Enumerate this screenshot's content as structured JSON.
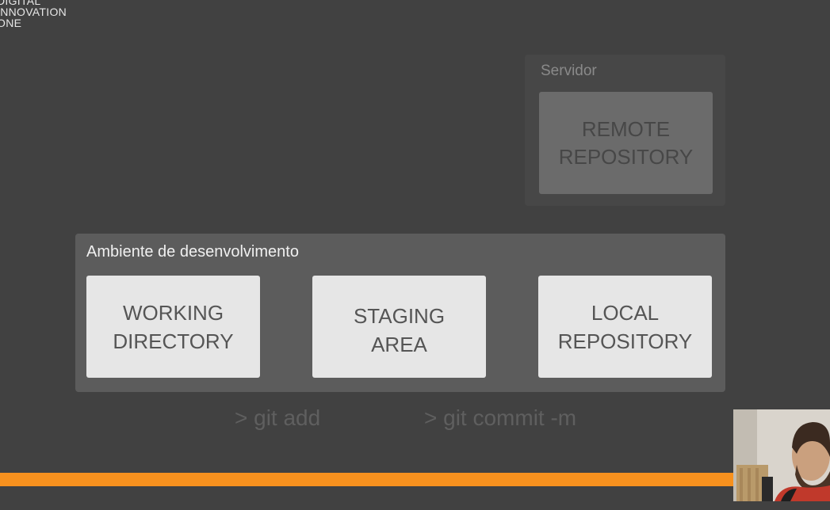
{
  "logo": {
    "lines": [
      "DIGITAL",
      "INNOVATION",
      "ONE"
    ]
  },
  "server": {
    "title": "Servidor",
    "remote_line1": "REMOTE",
    "remote_line2": "REPOSITORY"
  },
  "dev_env": {
    "title": "Ambiente de desenvolvimento",
    "working_line1": "WORKING",
    "working_line2": "DIRECTORY",
    "staging_line1": "STAGING",
    "staging_line2": "AREA",
    "local_line1": "LOCAL",
    "local_line2": "REPOSITORY"
  },
  "commands": {
    "git_add": "> git add",
    "git_commit": "> git commit -m"
  },
  "colors": {
    "background": "#414141",
    "accent_bar": "#f7911e",
    "card_light": "#e6e6e6",
    "card_dim": "#6b6b6b"
  },
  "icons": {
    "webcam": "presenter-webcam-feed"
  }
}
